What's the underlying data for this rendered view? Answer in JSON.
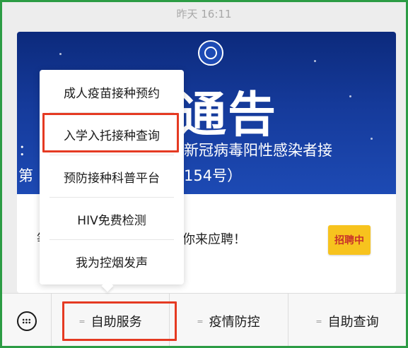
{
  "timestamp": "昨天 16:11",
  "banner": {
    "headline": "通告",
    "subline_1": "新冠病毒阳性感染者接",
    "subline_2": "154号）",
    "partial_left_1": "：",
    "partial_left_2": "第"
  },
  "article": {
    "partial_left": "等",
    "title": "你来应聘！",
    "badge": "招聘中"
  },
  "popup_menu": {
    "items": [
      {
        "label": "成人疫苗接种预约"
      },
      {
        "label": "入学入托接种查询"
      },
      {
        "label": "预防接种科普平台"
      },
      {
        "label": "HIV免费检测"
      },
      {
        "label": "我为控烟发声"
      }
    ]
  },
  "bottom_menu": {
    "keyboard_icon": "keyboard-icon",
    "tabs": [
      {
        "label": "自助服务"
      },
      {
        "label": "疫情防控"
      },
      {
        "label": "自助查询"
      }
    ]
  },
  "colors": {
    "highlight": "#e53a22",
    "frame": "#2c9c44",
    "banner": "#153a9a",
    "badge": "#f7c31e"
  }
}
